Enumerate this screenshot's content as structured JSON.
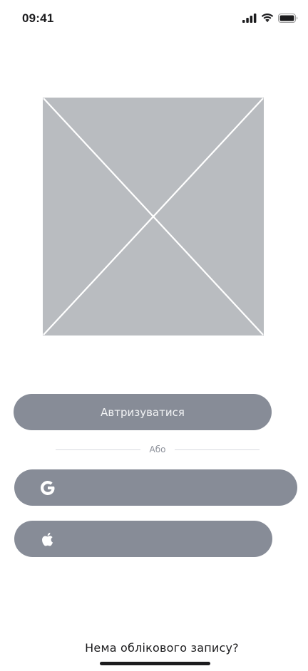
{
  "status_bar": {
    "time": "09:41",
    "icons": [
      "cellular-signal-icon",
      "wifi-icon",
      "battery-icon"
    ]
  },
  "hero": {
    "type": "image-placeholder",
    "fill": "#b9bcc0",
    "stroke": "#ffffff"
  },
  "login": {
    "primary_label": "Автризуватися",
    "divider_text": "Або",
    "social_buttons": [
      {
        "icon": "google-icon"
      },
      {
        "icon": "apple-icon"
      }
    ]
  },
  "footer": {
    "signup_prompt": "Нема облікового запису?"
  },
  "colors": {
    "button": "#878c97",
    "button_text": "#f2f3f5",
    "text": "#1c1c1e",
    "divider": "#d9dbe0",
    "divider_text": "#8e929b",
    "placeholder": "#b9bcc0"
  }
}
